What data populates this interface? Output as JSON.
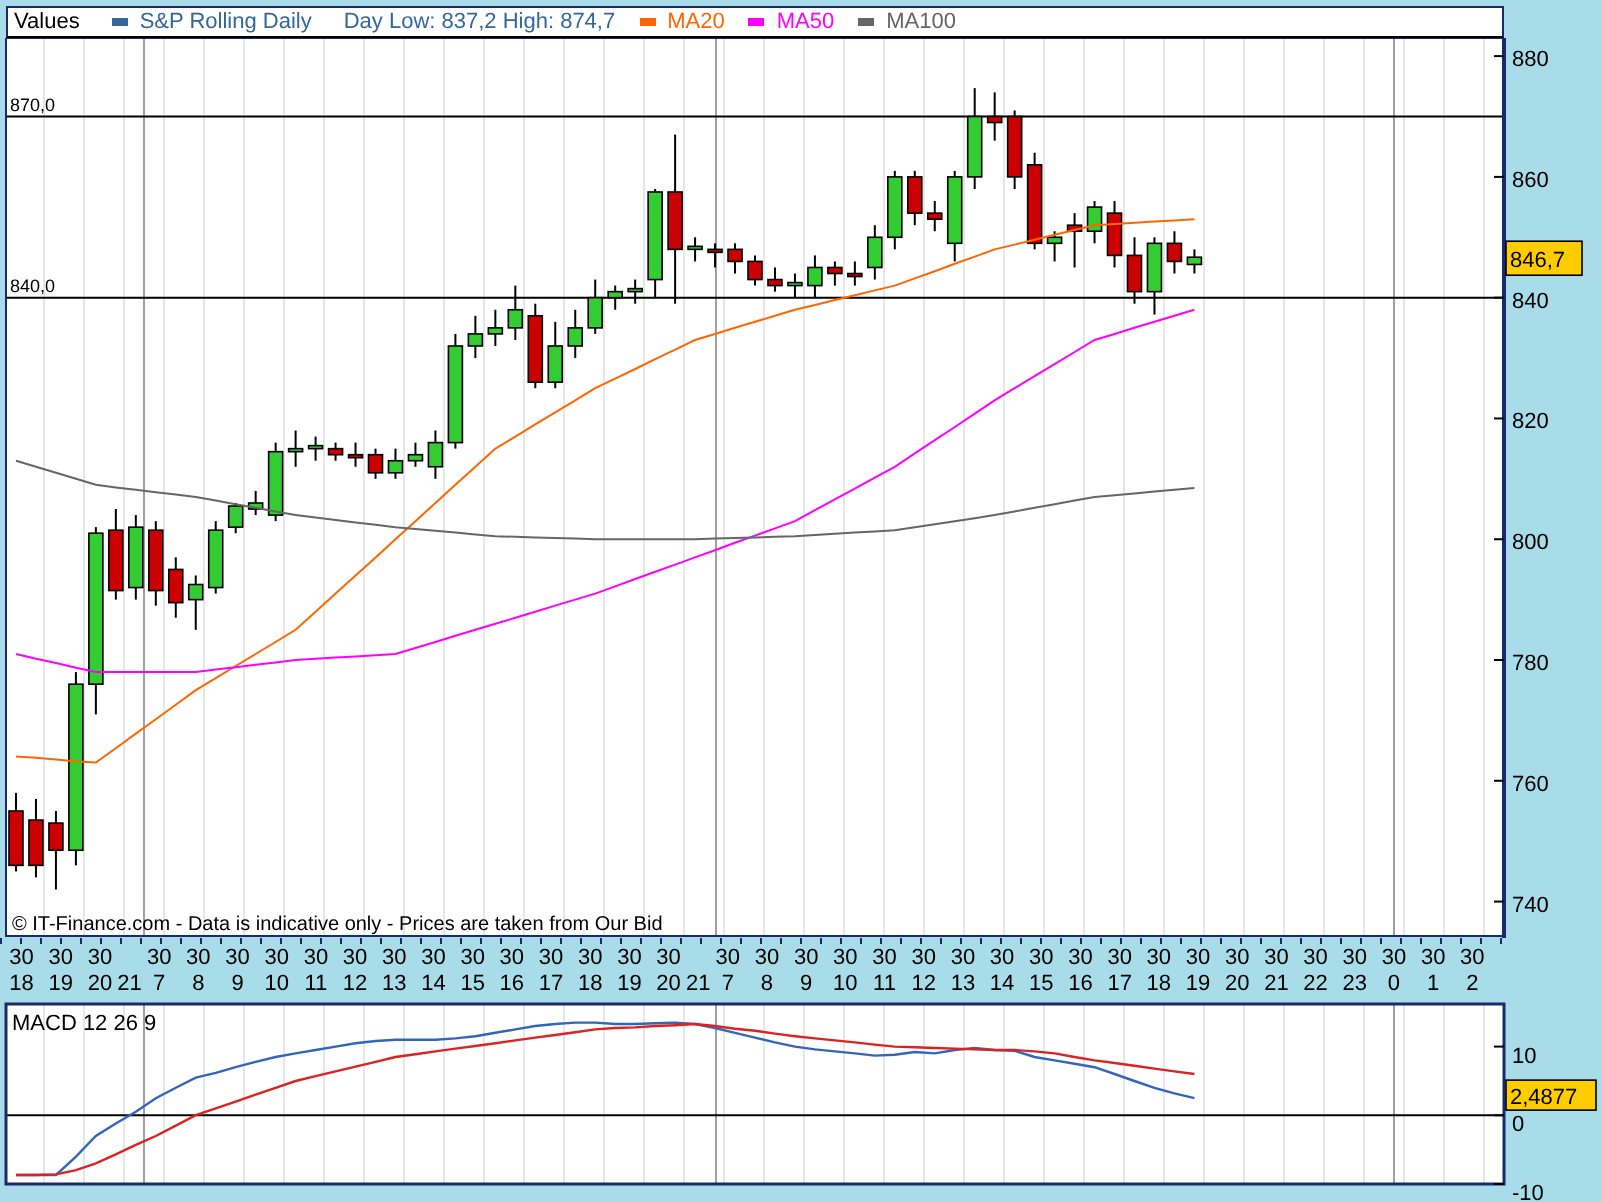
{
  "main_chart": {
    "legend_title": "Values",
    "price_series": {
      "name": "S&P Rolling Daily",
      "color": "#336699"
    },
    "day_range": "Day Low: 837,2 High: 874,7",
    "last_price": "846,7",
    "footnote": "© IT-Finance.com - Data is indicative only - Prices are taken from Our Bid",
    "chart_data": {
      "type": "candlestick",
      "ylim": [
        734.3,
        883
      ],
      "yticks": [
        740,
        760,
        780,
        800,
        820,
        840,
        860,
        880
      ],
      "grid": true,
      "categories": [
        null,
        null,
        null,
        null,
        null,
        null,
        null,
        null,
        null,
        null,
        null,
        null,
        null,
        null,
        null,
        null,
        null,
        null,
        null,
        null,
        null,
        null,
        null,
        null,
        null,
        null,
        null,
        null,
        null,
        null,
        null,
        null,
        null,
        null,
        null,
        null,
        null,
        null,
        null,
        null,
        null,
        null,
        null,
        null,
        null,
        null,
        null,
        null,
        null,
        null,
        null,
        null,
        null,
        null,
        null,
        null,
        null,
        null,
        null,
        null,
        null,
        null,
        null,
        null,
        null,
        null,
        null,
        null,
        null,
        null,
        null,
        null,
        null,
        null,
        null
      ],
      "ohlc": [
        [
          755,
          758,
          745,
          746
        ],
        [
          753.5,
          757,
          744,
          746
        ],
        [
          753,
          755,
          742,
          748.5
        ],
        [
          748.5,
          778,
          746,
          776
        ],
        [
          776,
          802,
          771,
          801
        ],
        [
          801.5,
          805,
          790,
          791.5
        ],
        [
          792,
          804,
          790,
          802
        ],
        [
          801.5,
          803,
          789,
          791.5
        ],
        [
          795,
          797,
          787,
          789.5
        ],
        [
          790,
          794,
          785,
          792.5
        ],
        [
          792,
          803,
          791,
          801.5
        ],
        [
          802,
          806,
          801,
          805.5
        ],
        [
          805,
          808,
          804,
          806
        ],
        [
          804,
          816,
          803,
          814.5
        ],
        [
          814.5,
          818,
          812,
          815
        ],
        [
          815,
          817,
          813,
          815.5
        ],
        [
          815,
          816,
          813,
          814
        ],
        [
          814,
          816,
          812,
          813.5
        ],
        [
          814,
          815,
          810,
          811
        ],
        [
          811,
          815,
          810,
          813
        ],
        [
          813,
          816,
          812,
          814
        ],
        [
          812,
          818,
          810,
          816
        ],
        [
          816,
          834,
          815,
          832
        ],
        [
          832,
          837,
          830,
          834
        ],
        [
          834,
          838,
          832,
          835
        ],
        [
          835,
          842,
          833,
          838
        ],
        [
          837,
          839,
          825,
          826
        ],
        [
          826,
          836,
          825,
          832
        ],
        [
          832,
          838,
          830,
          835
        ],
        [
          835,
          843,
          834,
          840
        ],
        [
          840,
          842,
          838,
          841
        ],
        [
          841,
          843,
          839,
          841.5
        ],
        [
          843,
          858,
          840,
          857.5
        ],
        [
          857.5,
          867,
          839,
          848
        ],
        [
          848,
          850,
          846,
          848.5
        ],
        [
          848,
          849,
          845,
          847.5
        ],
        [
          848,
          849,
          844,
          846
        ],
        [
          846,
          847,
          842,
          843
        ],
        [
          843,
          845,
          841,
          842
        ],
        [
          842,
          844,
          840,
          842.5
        ],
        [
          842,
          847,
          840,
          845
        ],
        [
          845,
          846,
          842,
          844
        ],
        [
          844,
          846,
          842,
          843.5
        ],
        [
          845,
          852,
          843,
          850
        ],
        [
          850,
          861,
          848,
          860
        ],
        [
          860,
          861,
          852,
          854
        ],
        [
          854,
          856,
          851,
          853
        ],
        [
          849,
          861,
          846,
          860
        ],
        [
          860,
          874.7,
          858,
          870
        ],
        [
          870,
          874,
          866,
          869
        ],
        [
          870,
          871,
          858,
          860
        ],
        [
          862,
          864,
          848,
          849
        ],
        [
          849,
          851,
          846,
          850
        ],
        [
          852,
          854,
          845,
          851
        ],
        [
          851,
          856,
          849,
          855
        ],
        [
          854,
          856,
          845,
          847
        ],
        [
          847,
          850,
          839,
          841
        ],
        [
          841,
          850,
          837.2,
          849
        ],
        [
          849,
          851,
          844,
          846
        ],
        [
          845.5,
          848,
          844,
          846.7
        ],
        null,
        null,
        null,
        null,
        null,
        null,
        null,
        null,
        null,
        null,
        null,
        null,
        null,
        null,
        null
      ],
      "series": [
        {
          "name": "MA20",
          "type": "line",
          "color": "#ff6600",
          "values": [
            764,
            763.8,
            763.5,
            763.2,
            763,
            765.4,
            767.8,
            770.2,
            772.6,
            775,
            777,
            779,
            781,
            783,
            785,
            788,
            791,
            794,
            797,
            800,
            803,
            806,
            809,
            812,
            815,
            817,
            819,
            821,
            823,
            825,
            826.6,
            828.2,
            829.8,
            831.4,
            833,
            834,
            835,
            836,
            837,
            838,
            838.8,
            839.6,
            840.4,
            841.2,
            842,
            843.2,
            844.4,
            845.6,
            846.8,
            848,
            848.8,
            849.6,
            850.4,
            851.2,
            852,
            852.2,
            852.4,
            852.6,
            852.8,
            853,
            null,
            null,
            null,
            null,
            null,
            null,
            null,
            null,
            null,
            null,
            null,
            null,
            null,
            null,
            null
          ]
        },
        {
          "name": "MA50",
          "type": "line",
          "color": "#ff00ff",
          "values": [
            781,
            780.2,
            779.5,
            778.7,
            778,
            778,
            778,
            778,
            778,
            778,
            778.4,
            778.8,
            779.2,
            779.6,
            780,
            780.2,
            780.4,
            780.6,
            780.8,
            781,
            782,
            783,
            784,
            785,
            786,
            787,
            788,
            789,
            790,
            791,
            792.2,
            793.4,
            794.6,
            795.8,
            797,
            798.2,
            799.4,
            800.6,
            801.8,
            803,
            804.8,
            806.6,
            808.4,
            810.2,
            812,
            814.2,
            816.4,
            818.6,
            820.8,
            823,
            825,
            827,
            829,
            831,
            833,
            834,
            835,
            836,
            837,
            838,
            null,
            null,
            null,
            null,
            null,
            null,
            null,
            null,
            null,
            null,
            null,
            null,
            null,
            null,
            null
          ]
        },
        {
          "name": "MA100",
          "type": "line",
          "color": "#666666",
          "values": [
            813,
            812,
            811,
            810,
            809,
            808.6,
            808.2,
            807.8,
            807.4,
            807,
            806.4,
            805.8,
            805.2,
            804.6,
            804,
            803.6,
            803.2,
            802.8,
            802.4,
            802,
            801.7,
            801.4,
            801.1,
            800.8,
            800.5,
            800.4,
            800.3,
            800.2,
            800.1,
            800,
            800,
            800,
            800,
            800,
            800,
            800.1,
            800.2,
            800.3,
            800.4,
            800.5,
            800.7,
            800.9,
            801.1,
            801.3,
            801.5,
            802,
            802.5,
            803,
            803.5,
            804,
            804.6,
            805.2,
            805.8,
            806.4,
            807,
            807.3,
            807.6,
            807.9,
            808.2,
            808.5,
            null,
            null,
            null,
            null,
            null,
            null,
            null,
            null,
            null,
            null,
            null,
            null,
            null,
            null,
            null
          ]
        }
      ],
      "ref_lines": [
        {
          "axis": "y",
          "value": 870,
          "label": "870,0"
        },
        {
          "axis": "y",
          "value": 840,
          "label": "840,0"
        }
      ]
    }
  },
  "time_axis": [
    {
      "minute": "30",
      "hour": "18"
    },
    {
      "minute": "30",
      "hour": "19"
    },
    {
      "minute": "30",
      "hour": "20"
    },
    {
      "hour": "21"
    },
    {
      "minute": "30",
      "hour": "7"
    },
    {
      "minute": "30",
      "hour": "8"
    },
    {
      "minute": "30",
      "hour": "9"
    },
    {
      "minute": "30",
      "hour": "10"
    },
    {
      "minute": "30",
      "hour": "11"
    },
    {
      "minute": "30",
      "hour": "12"
    },
    {
      "minute": "30",
      "hour": "13"
    },
    {
      "minute": "30",
      "hour": "14"
    },
    {
      "minute": "30",
      "hour": "15"
    },
    {
      "minute": "30",
      "hour": "16"
    },
    {
      "minute": "30",
      "hour": "17"
    },
    {
      "minute": "30",
      "hour": "18"
    },
    {
      "minute": "30",
      "hour": "19"
    },
    {
      "minute": "30",
      "hour": "20"
    },
    {
      "hour": "21"
    },
    {
      "minute": "30",
      "hour": "7"
    },
    {
      "minute": "30",
      "hour": "8"
    },
    {
      "minute": "30",
      "hour": "9"
    },
    {
      "minute": "30",
      "hour": "10"
    },
    {
      "minute": "30",
      "hour": "11"
    },
    {
      "minute": "30",
      "hour": "12"
    },
    {
      "minute": "30",
      "hour": "13"
    },
    {
      "minute": "30",
      "hour": "14"
    },
    {
      "minute": "30",
      "hour": "15"
    },
    {
      "minute": "30",
      "hour": "16"
    },
    {
      "minute": "30",
      "hour": "17"
    },
    {
      "minute": "30",
      "hour": "18"
    },
    {
      "minute": "30",
      "hour": "19"
    },
    {
      "minute": "30",
      "hour": "20"
    },
    {
      "minute": "30",
      "hour": "21"
    },
    {
      "minute": "30",
      "hour": "22"
    },
    {
      "minute": "30",
      "hour": "23"
    },
    {
      "minute": "30",
      "hour": "0"
    },
    {
      "minute": "30",
      "hour": "1"
    },
    {
      "minute": "30",
      "hour": "2"
    }
  ],
  "macd_panel": {
    "last_value": "2,4877",
    "chart_data": {
      "type": "line",
      "title": "MACD 12 26 9",
      "categories": [
        null,
        null,
        null,
        null,
        null,
        null,
        null,
        null,
        null,
        null,
        null,
        null,
        null,
        null,
        null,
        null,
        null,
        null,
        null,
        null,
        null,
        null,
        null,
        null,
        null,
        null,
        null,
        null,
        null,
        null,
        null,
        null,
        null,
        null,
        null,
        null,
        null,
        null,
        null,
        null,
        null,
        null,
        null,
        null,
        null,
        null,
        null,
        null,
        null,
        null,
        null,
        null,
        null,
        null,
        null,
        null,
        null,
        null,
        null,
        null,
        null,
        null,
        null,
        null,
        null,
        null,
        null,
        null,
        null,
        null,
        null,
        null,
        null,
        null,
        null
      ],
      "ylim": [
        -10,
        16.2
      ],
      "yticks": [
        -10,
        0,
        10
      ],
      "grid": true,
      "series": [
        {
          "color": "#3366bb",
          "values": [
            -8.7,
            -8.7,
            -8.7,
            -6,
            -3,
            -1.2,
            0.5,
            2.5,
            4,
            5.5,
            6.2,
            7,
            7.8,
            8.5,
            9,
            9.5,
            10,
            10.5,
            10.8,
            11,
            11,
            11,
            11.2,
            11.5,
            12,
            12.5,
            13,
            13.3,
            13.5,
            13.5,
            13.3,
            13.3,
            13.4,
            13.5,
            13.3,
            12.7,
            12,
            11.3,
            10.6,
            10,
            9.6,
            9.3,
            9,
            8.7,
            8.8,
            9.2,
            9,
            9.5,
            9.8,
            9.5,
            9.4,
            8.5,
            8,
            7.5,
            7,
            6,
            5,
            4,
            3.2,
            2.5,
            null,
            null,
            null,
            null,
            null,
            null,
            null,
            null,
            null,
            null,
            null,
            null,
            null,
            null,
            null
          ]
        },
        {
          "color": "#dd2222",
          "values": [
            -8.7,
            -8.7,
            -8.6,
            -8,
            -7,
            -5.7,
            -4.3,
            -3,
            -1.5,
            0,
            1,
            2,
            3,
            4,
            5,
            5.7,
            6.4,
            7.1,
            7.8,
            8.5,
            8.9,
            9.3,
            9.7,
            10.1,
            10.5,
            10.9,
            11.3,
            11.7,
            12.1,
            12.5,
            12.7,
            12.8,
            13,
            13.1,
            13.3,
            13,
            12.6,
            12.3,
            11.9,
            11.5,
            11.2,
            10.9,
            10.6,
            10.3,
            10,
            9.9,
            9.8,
            9.7,
            9.6,
            9.5,
            9.5,
            9.3,
            9,
            8.5,
            8,
            7.6,
            7.2,
            6.8,
            6.4,
            6,
            null,
            null,
            null,
            null,
            null,
            null,
            null,
            null,
            null,
            null,
            null,
            null,
            null,
            null,
            null
          ]
        }
      ],
      "ref_lines": [
        {
          "axis": "y",
          "value": 0
        }
      ]
    }
  }
}
